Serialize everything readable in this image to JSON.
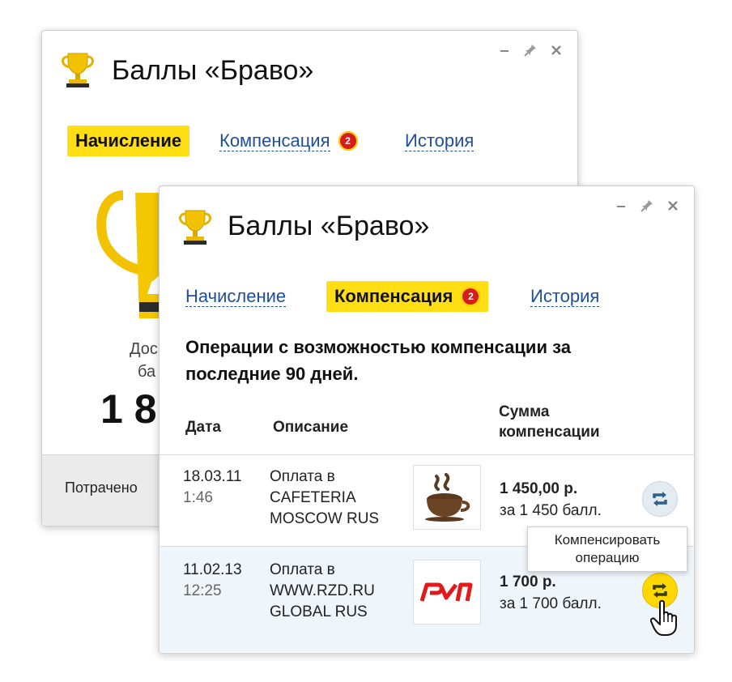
{
  "back_window": {
    "title": "Баллы «Браво»",
    "tabs": [
      {
        "label": "Начисление",
        "active": true
      },
      {
        "label": "Компенсация",
        "badge": "2",
        "active": false
      },
      {
        "label": "История",
        "active": false
      }
    ],
    "partial_available_line1": "Дос",
    "partial_available_line2": "ба",
    "partial_balance": "1 8",
    "partial_spent": "Потрачено"
  },
  "front_window": {
    "title": "Баллы «Браво»",
    "tabs": [
      {
        "label": "Начисление",
        "active": false
      },
      {
        "label": "Компенсация",
        "badge": "2",
        "active": true
      },
      {
        "label": "История",
        "active": false
      }
    ],
    "heading_line1": "Операции с возможностью компенсации за",
    "heading_line2": "последние 90 дней.",
    "columns": {
      "date": "Дата",
      "description": "Описание",
      "amount_line1": "Сумма",
      "amount_line2": "компенсации"
    },
    "rows": [
      {
        "date": "18.03.11",
        "time": "1:46",
        "desc_line1": "Оплата в",
        "desc_line2": "CAFETERIA",
        "desc_line3": "MOSCOW RUS",
        "logo": "coffee-cup-icon",
        "amount": "1 450,00 р.",
        "points": "за 1 450 балл."
      },
      {
        "date": "11.02.13",
        "time": "12:25",
        "desc_line1": "Оплата в",
        "desc_line2": "WWW.RZD.RU",
        "desc_line3": "GLOBAL RUS",
        "logo": "rzd-logo",
        "amount": "1 700 р.",
        "points": "за 1 700 балл."
      }
    ],
    "tooltip_line1": "Компенсировать",
    "tooltip_line2": "операцию"
  },
  "colors": {
    "accent_yellow": "#ffde14",
    "badge_red": "#d41e1e",
    "link_blue": "#1f4e9a",
    "row_highlight": "#eef5fb",
    "rzd_red": "#e21a1a"
  }
}
